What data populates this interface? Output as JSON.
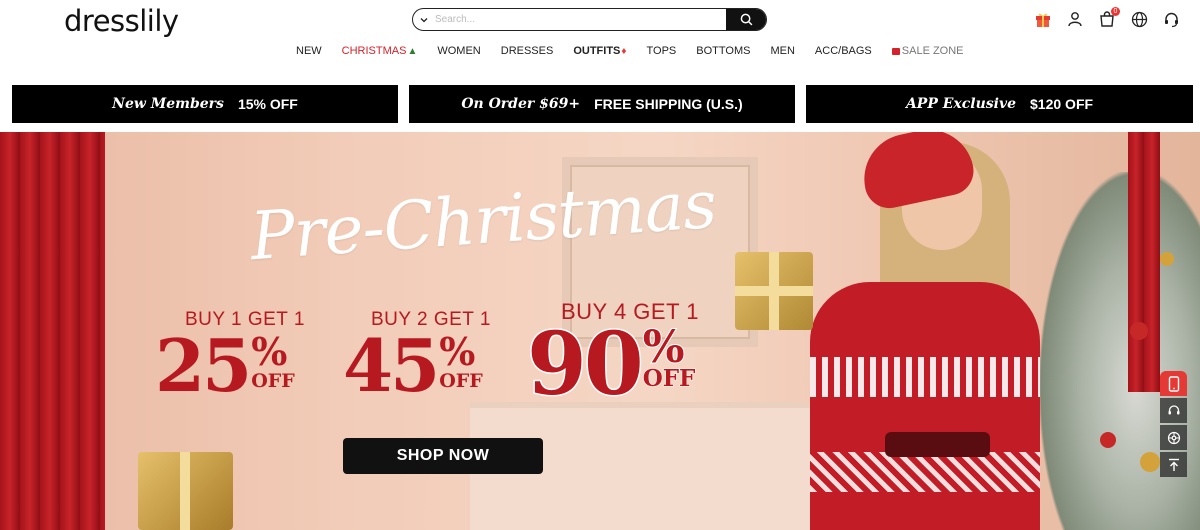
{
  "brand": {
    "logo": "dresslily"
  },
  "search": {
    "placeholder": "Search..."
  },
  "header_icons": [
    {
      "name": "gift-icon",
      "color": "#e53935"
    },
    {
      "name": "user-icon"
    },
    {
      "name": "cart-icon",
      "badge": "0"
    },
    {
      "name": "globe-icon"
    },
    {
      "name": "headset-icon"
    }
  ],
  "nav": {
    "items": [
      {
        "label": "NEW"
      },
      {
        "label": "CHRISTMAS"
      },
      {
        "label": "WOMEN"
      },
      {
        "label": "DRESSES"
      },
      {
        "label": "OUTFITS"
      },
      {
        "label": "TOPS"
      },
      {
        "label": "BOTTOMS"
      },
      {
        "label": "MEN"
      },
      {
        "label": "ACC/BAGS"
      },
      {
        "label": "SALE ZONE"
      }
    ]
  },
  "promo_strip": {
    "members": {
      "script": "New Members",
      "bold": "15% OFF"
    },
    "shipping": {
      "script": "On Order $69+",
      "bold": "FREE SHIPPING (U.S.)"
    },
    "app": {
      "script": "APP Exclusive",
      "bold": "$120 OFF"
    }
  },
  "hero": {
    "title": "Pre-Christmas",
    "offers": [
      {
        "label": "BUY 1 GET 1",
        "number": "25",
        "percent": "%",
        "off": "OFF"
      },
      {
        "label": "BUY 2 GET 1",
        "number": "45",
        "percent": "%",
        "off": "OFF"
      },
      {
        "label": "BUY 4 GET 1",
        "number": "90",
        "percent": "%",
        "off": "OFF"
      }
    ],
    "cta": "SHOP NOW"
  },
  "colors": {
    "accent": "#b61a20",
    "christmas_nav": "#d4222a",
    "black": "#111111"
  }
}
